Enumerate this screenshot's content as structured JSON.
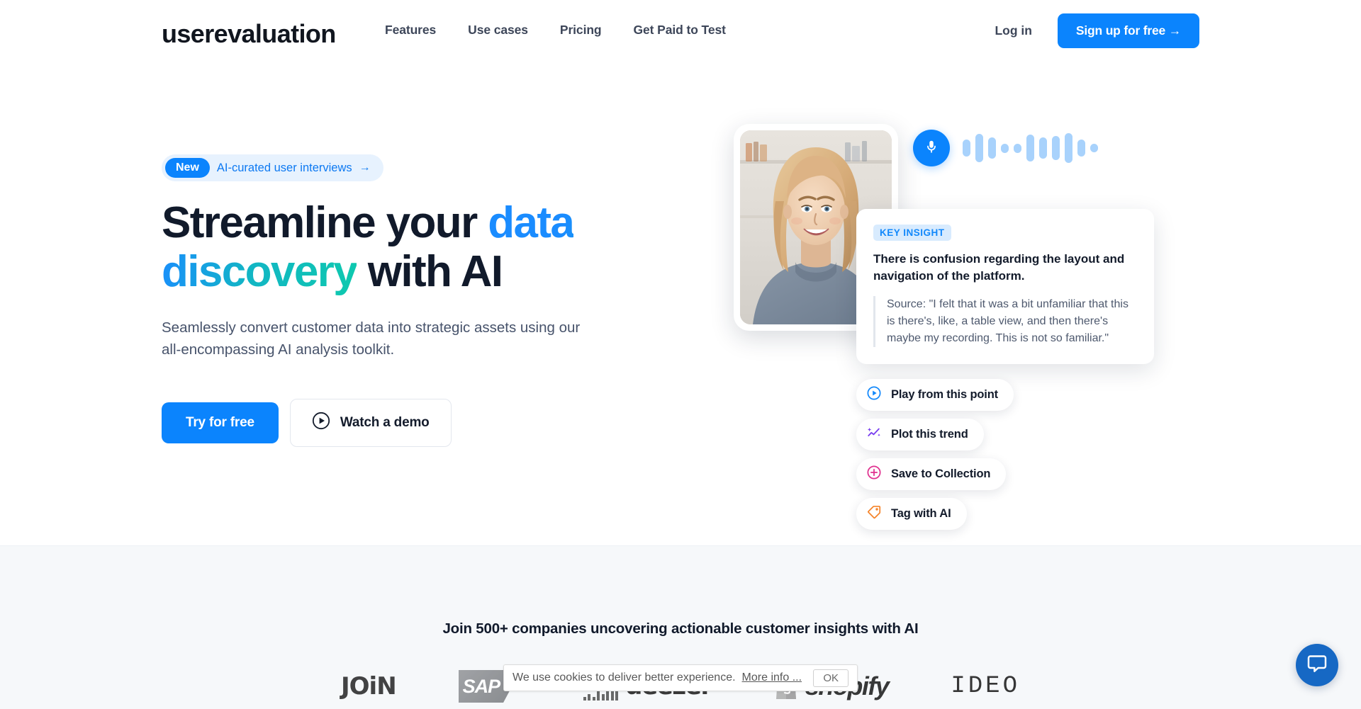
{
  "header": {
    "logo": "userevaluation",
    "nav": [
      {
        "label": "Features",
        "name": "features"
      },
      {
        "label": "Use cases",
        "name": "use-cases"
      },
      {
        "label": "Pricing",
        "name": "pricing"
      },
      {
        "label": "Get Paid to Test",
        "name": "get-paid-to-test"
      }
    ],
    "login_label": "Log in",
    "signup_label": "Sign up for free →"
  },
  "hero": {
    "badge": {
      "tag": "New",
      "text": "AI-curated user interviews",
      "arrow": "→"
    },
    "headline": {
      "part1": "Streamline your ",
      "highlight": "data discovery",
      "part2": " with AI"
    },
    "subhead": "Seamlessly convert customer data into strategic assets using our all-encompassing AI analysis toolkit.",
    "cta_primary": "Try for free",
    "cta_secondary": "Watch a demo"
  },
  "insight_panel": {
    "tag": "KEY INSIGHT",
    "title": "There is confusion regarding the layout and navigation of the platform.",
    "quote": "Source: \"I felt that it was a bit unfamiliar that this is there's, like, a table view, and then there's maybe my recording. This is not so familiar.\"",
    "actions": [
      {
        "label": "Play from this point",
        "icon": "play-circle-icon",
        "color": "#1288fb"
      },
      {
        "label": "Plot this trend",
        "icon": "sparkle-trend-icon",
        "color": "#7a3ff0"
      },
      {
        "label": "Save to Collection",
        "icon": "plus-circle-icon",
        "color": "#e0308f"
      },
      {
        "label": "Tag with AI",
        "icon": "tag-icon",
        "color": "#f5842a"
      }
    ],
    "waveform_heights": [
      24,
      40,
      30,
      13,
      13,
      38,
      30,
      34,
      42,
      24,
      12
    ]
  },
  "logos_section": {
    "title": "Join 500+ companies uncovering actionable customer insights with AI",
    "logos": [
      {
        "name": "join",
        "text": "JOiN"
      },
      {
        "name": "sap",
        "text": "SAP"
      },
      {
        "name": "deezer",
        "text": "deezer"
      },
      {
        "name": "shopify",
        "text": "shopify"
      },
      {
        "name": "ideo",
        "text": "IDEO"
      }
    ]
  },
  "cookie_banner": {
    "text": "We use cookies to deliver better experience.",
    "more_info": "More info ...",
    "ok_label": "OK"
  },
  "colors": {
    "brand_blue": "#0b84fd",
    "gradient_start": "#1a8cff",
    "gradient_end": "#0ec9ae",
    "text_dark": "#111a2b",
    "text_muted": "#47536b"
  }
}
